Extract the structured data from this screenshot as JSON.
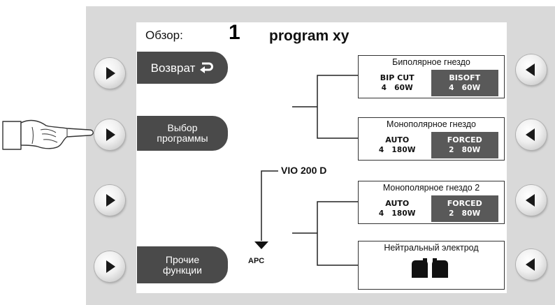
{
  "header": {
    "label": "Обзор:",
    "program_number": "1",
    "program_name": "program xy"
  },
  "soft_keys": {
    "back": "Возврат",
    "program_select": "Выбор\nпрограммы",
    "other_functions": "Прочие\nфункции"
  },
  "device_name": "VIO 200 D",
  "apc_label": "APC",
  "sockets": [
    {
      "title": "Биполярное гнездо",
      "modes": [
        {
          "name": "BIP CUT",
          "effect": "4",
          "power": "60W",
          "active": false
        },
        {
          "name": "BISOFT",
          "effect": "4",
          "power": "60W",
          "active": true
        }
      ]
    },
    {
      "title": "Монополярное гнездо",
      "modes": [
        {
          "name": "AUTO",
          "effect": "4",
          "power": "180W",
          "active": false
        },
        {
          "name": "FORCED",
          "effect": "2",
          "power": "80W",
          "active": true
        }
      ]
    },
    {
      "title": "Монополярное гнездо 2",
      "modes": [
        {
          "name": "AUTO",
          "effect": "4",
          "power": "180W",
          "active": false
        },
        {
          "name": "FORCED",
          "effect": "2",
          "power": "80W",
          "active": true
        }
      ]
    },
    {
      "title": "Нейтральный электрод"
    }
  ],
  "colors": {
    "soft_key": "#4a4a4a",
    "active_mode": "#595959",
    "device_frame": "#d9d9d9"
  },
  "icons": {
    "left_buttons": "play-right-icon",
    "right_buttons": "play-left-icon",
    "neutral": "neutral-electrode-icon",
    "pointer": "pointing-hand-icon",
    "back": "return-arrow-icon"
  }
}
